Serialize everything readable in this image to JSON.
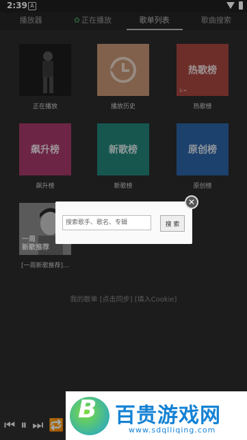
{
  "status": {
    "time": "2:39"
  },
  "tabs": [
    {
      "label": "播放器"
    },
    {
      "label": "正在播放"
    },
    {
      "label": "歌单列表"
    },
    {
      "label": "歌曲搜索"
    }
  ],
  "grid": [
    {
      "label": "正在播放",
      "cover_text": "",
      "color": "#1e1e1e"
    },
    {
      "label": "播放历史",
      "cover_text": "",
      "color": "#c79574"
    },
    {
      "label": "热歌榜",
      "cover_text": "热歌榜",
      "color": "#a8453f"
    },
    {
      "label": "飙升榜",
      "cover_text": "飙升榜",
      "color": "#a8396b"
    },
    {
      "label": "新歌榜",
      "cover_text": "新歌榜",
      "color": "#22857a"
    },
    {
      "label": "原创榜",
      "cover_text": "原创榜",
      "color": "#2c64a6"
    },
    {
      "label": "[一周新歌推荐]…",
      "cover_text": "一周\n新歌推荐",
      "color": "#8d8d8d"
    }
  ],
  "mylist": {
    "label": "我的歌单  [点击同步]  [填入Cookie]"
  },
  "dialog": {
    "placeholder": "搜索歌手、歌名、专辑",
    "button": "搜 索"
  },
  "banner": {
    "brand": "百贵游戏网",
    "url": "www.sdqlliqing.com"
  }
}
